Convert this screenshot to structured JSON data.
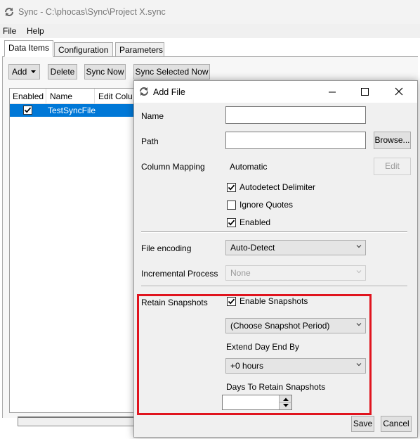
{
  "main_window": {
    "title": "Sync - C:\\phocas\\Sync\\Project X.sync",
    "menu": [
      "File",
      "Help"
    ],
    "tabs": [
      "Data Items",
      "Configuration",
      "Parameters"
    ],
    "toolbar": {
      "add_label": "Add",
      "delete_label": "Delete",
      "sync_now_label": "Sync Now",
      "sync_selected_label": "Sync Selected Now"
    },
    "grid": {
      "columns": [
        "Enabled",
        "Name",
        "Edit Colu"
      ],
      "rows": [
        {
          "enabled": true,
          "name": "TestSyncFile"
        }
      ]
    }
  },
  "dialog": {
    "title": "Add File",
    "name_label": "Name",
    "name_value": "",
    "path_label": "Path",
    "path_value": "",
    "browse_label": "Browse...",
    "column_mapping_label": "Column Mapping",
    "column_mapping_value": "Automatic",
    "edit_label": "Edit",
    "autodetect_delimiter_label": "Autodetect Delimiter",
    "autodetect_delimiter_checked": true,
    "ignore_quotes_label": "Ignore Quotes",
    "ignore_quotes_checked": false,
    "enabled_label": "Enabled",
    "enabled_checked": true,
    "file_encoding_label": "File encoding",
    "file_encoding_value": "Auto-Detect",
    "incremental_process_label": "Incremental Process",
    "incremental_process_value": "None",
    "retain_snapshots_label": "Retain Snapshots",
    "enable_snapshots_label": "Enable Snapshots",
    "enable_snapshots_checked": true,
    "snapshot_period_value": "(Choose Snapshot Period)",
    "extend_day_end_label": "Extend Day End By",
    "extend_day_end_value": "+0 hours",
    "days_to_retain_label": "Days To Retain Snapshots",
    "days_to_retain_value": "",
    "save_label": "Save",
    "cancel_label": "Cancel"
  },
  "colors": {
    "selection": "#0078d7",
    "highlight_box": "#e0141e",
    "dialog_bg": "#f0f0f0"
  },
  "icons": [
    "sync-icon",
    "minimize-icon",
    "maximize-icon",
    "close-icon",
    "dropdown-arrow-icon",
    "checkmark-icon",
    "spin-up-icon",
    "spin-down-icon"
  ]
}
